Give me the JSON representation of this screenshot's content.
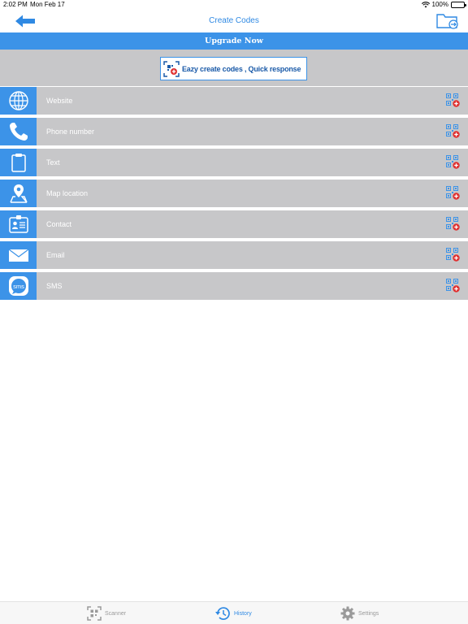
{
  "status": {
    "time": "2:02 PM",
    "date": "Mon Feb 17",
    "battery": "100%"
  },
  "nav": {
    "title": "Create Codes",
    "back_icon": "arrow-left-icon",
    "folder_icon": "folder-export-icon"
  },
  "upgrade": {
    "label": "Upgrade Now"
  },
  "banner": {
    "text": "Eazy create codes , Quick response"
  },
  "items": [
    {
      "label": "Website",
      "icon": "globe-icon"
    },
    {
      "label": "Phone number",
      "icon": "phone-icon"
    },
    {
      "label": "Text",
      "icon": "clipboard-icon"
    },
    {
      "label": "Map location",
      "icon": "map-pin-icon"
    },
    {
      "label": "Contact",
      "icon": "contact-card-icon"
    },
    {
      "label": "Email",
      "icon": "envelope-icon"
    },
    {
      "label": "SMS",
      "icon": "sms-bubble-icon"
    }
  ],
  "tabs": [
    {
      "label": "Scanner",
      "icon": "qr-scan-icon",
      "active": false
    },
    {
      "label": "History",
      "icon": "history-icon",
      "active": true
    },
    {
      "label": "Settings",
      "icon": "gear-icon",
      "active": false
    }
  ],
  "colors": {
    "accent": "#3c93e8",
    "row_bg": "#c7c7c9",
    "add_badge": "#e03030"
  }
}
